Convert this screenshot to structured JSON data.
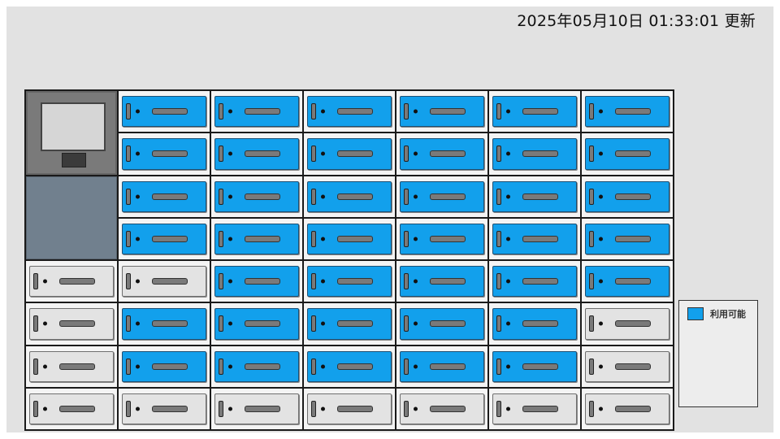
{
  "header": {
    "updated_text": "2025年05月10日 01:33:01 更新"
  },
  "legend": {
    "available_label": "利用可能",
    "available_color": "#12a0ec"
  },
  "lockers": {
    "columns": 7,
    "rows": 8,
    "rows_status": [
      [
        "terminal",
        "free",
        "free",
        "free",
        "free",
        "free",
        "free"
      ],
      [
        "terminal",
        "free",
        "free",
        "free",
        "free",
        "free",
        "free"
      ],
      [
        "panel",
        "free",
        "free",
        "free",
        "free",
        "free",
        "free"
      ],
      [
        "panel",
        "free",
        "free",
        "free",
        "free",
        "free",
        "free"
      ],
      [
        "used",
        "used",
        "free",
        "free",
        "free",
        "free",
        "free"
      ],
      [
        "used",
        "free",
        "free",
        "free",
        "free",
        "free",
        "used"
      ],
      [
        "used",
        "free",
        "free",
        "free",
        "free",
        "free",
        "used"
      ],
      [
        "used",
        "used",
        "used",
        "used",
        "used",
        "used",
        "used"
      ]
    ]
  }
}
